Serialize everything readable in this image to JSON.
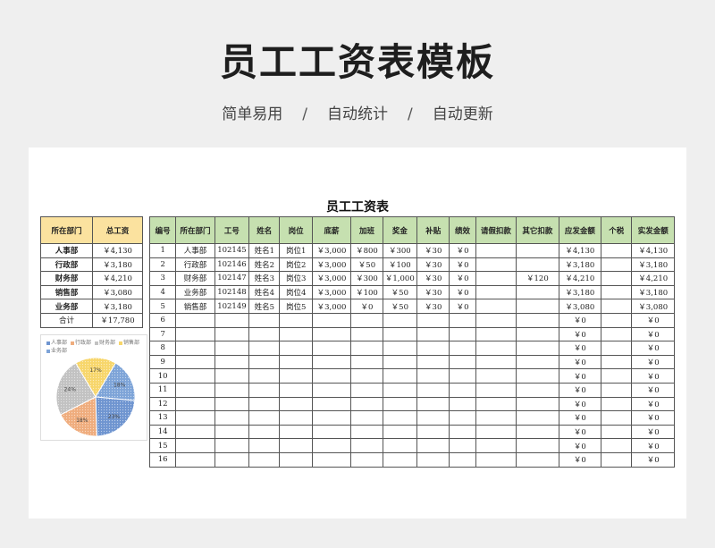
{
  "header": {
    "title": "员工工资表模板",
    "tagline": [
      "简单易用",
      "自动统计",
      "自动更新"
    ],
    "separator": "/"
  },
  "sheet": {
    "title": "员工工资表",
    "dept_table": {
      "headers": [
        "所在部门",
        "总工资"
      ],
      "rows": [
        [
          "人事部",
          "￥4,130"
        ],
        [
          "行政部",
          "￥3,180"
        ],
        [
          "财务部",
          "￥4,210"
        ],
        [
          "销售部",
          "￥3,080"
        ],
        [
          "业务部",
          "￥3,180"
        ]
      ],
      "total": [
        "合计",
        "￥17,780"
      ]
    },
    "main_table": {
      "headers": [
        "编号",
        "所在部门",
        "工号",
        "姓名",
        "岗位",
        "底薪",
        "加班",
        "奖金",
        "补贴",
        "绩效",
        "请假扣款",
        "其它扣款",
        "应发金额",
        "个税",
        "实发金额"
      ],
      "rows": [
        [
          "1",
          "人事部",
          "102145",
          "姓名1",
          "岗位1",
          "￥3,000",
          "￥800",
          "￥300",
          "￥30",
          "￥0",
          "",
          "",
          "￥4,130",
          "",
          "￥4,130"
        ],
        [
          "2",
          "行政部",
          "102146",
          "姓名2",
          "岗位2",
          "￥3,000",
          "￥50",
          "￥100",
          "￥30",
          "￥0",
          "",
          "",
          "￥3,180",
          "",
          "￥3,180"
        ],
        [
          "3",
          "财务部",
          "102147",
          "姓名3",
          "岗位3",
          "￥3,000",
          "￥300",
          "￥1,000",
          "￥30",
          "￥0",
          "",
          "￥120",
          "￥4,210",
          "",
          "￥4,210"
        ],
        [
          "4",
          "业务部",
          "102148",
          "姓名4",
          "岗位4",
          "￥3,000",
          "￥100",
          "￥50",
          "￥30",
          "￥0",
          "",
          "",
          "￥3,180",
          "",
          "￥3,180"
        ],
        [
          "5",
          "销售部",
          "102149",
          "姓名5",
          "岗位5",
          "￥3,000",
          "￥0",
          "￥50",
          "￥30",
          "￥0",
          "",
          "",
          "￥3,080",
          "",
          "￥3,080"
        ],
        [
          "6",
          "",
          "",
          "",
          "",
          "",
          "",
          "",
          "",
          "",
          "",
          "",
          "￥0",
          "",
          "￥0"
        ],
        [
          "7",
          "",
          "",
          "",
          "",
          "",
          "",
          "",
          "",
          "",
          "",
          "",
          "￥0",
          "",
          "￥0"
        ],
        [
          "8",
          "",
          "",
          "",
          "",
          "",
          "",
          "",
          "",
          "",
          "",
          "",
          "￥0",
          "",
          "￥0"
        ],
        [
          "9",
          "",
          "",
          "",
          "",
          "",
          "",
          "",
          "",
          "",
          "",
          "",
          "￥0",
          "",
          "￥0"
        ],
        [
          "10",
          "",
          "",
          "",
          "",
          "",
          "",
          "",
          "",
          "",
          "",
          "",
          "￥0",
          "",
          "￥0"
        ],
        [
          "11",
          "",
          "",
          "",
          "",
          "",
          "",
          "",
          "",
          "",
          "",
          "",
          "￥0",
          "",
          "￥0"
        ],
        [
          "12",
          "",
          "",
          "",
          "",
          "",
          "",
          "",
          "",
          "",
          "",
          "",
          "￥0",
          "",
          "￥0"
        ],
        [
          "13",
          "",
          "",
          "",
          "",
          "",
          "",
          "",
          "",
          "",
          "",
          "",
          "￥0",
          "",
          "￥0"
        ],
        [
          "14",
          "",
          "",
          "",
          "",
          "",
          "",
          "",
          "",
          "",
          "",
          "",
          "￥0",
          "",
          "￥0"
        ],
        [
          "15",
          "",
          "",
          "",
          "",
          "",
          "",
          "",
          "",
          "",
          "",
          "",
          "￥0",
          "",
          "￥0"
        ],
        [
          "16",
          "",
          "",
          "",
          "",
          "",
          "",
          "",
          "",
          "",
          "",
          "",
          "￥0",
          "",
          "￥0"
        ]
      ]
    }
  },
  "chart_data": {
    "type": "pie",
    "title": "",
    "categories": [
      "人事部",
      "行政部",
      "财务部",
      "销售部",
      "业务部"
    ],
    "values": [
      23,
      18,
      24,
      17,
      18
    ],
    "labels": [
      "23%",
      "18%",
      "24%",
      "17%",
      "18%"
    ],
    "colors": [
      "#6f95d0",
      "#efad7e",
      "#c2c2c2",
      "#f7d66b",
      "#7ea4d8"
    ],
    "legend": "top"
  }
}
